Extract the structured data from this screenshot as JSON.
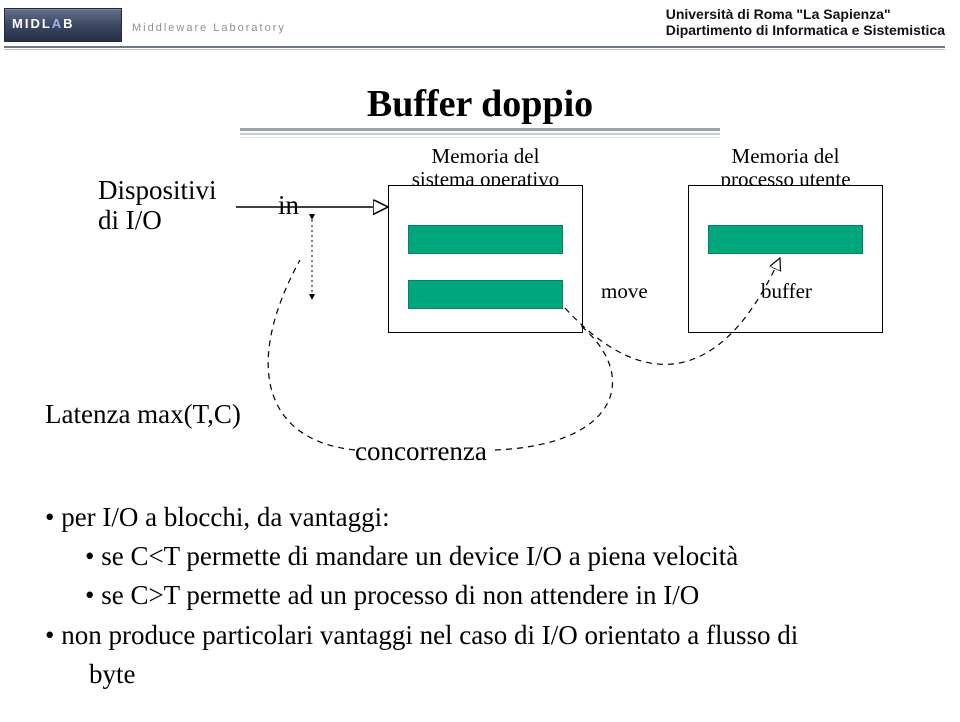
{
  "header": {
    "logo_main": "MIDL",
    "logo_accent": "A",
    "logo_end": "B",
    "logo_subtitle": "Middleware Laboratory",
    "university_line1": "Università di Roma \"La Sapienza\"",
    "university_line2": "Dipartimento di Informatica e Sistemistica"
  },
  "title": "Buffer doppio",
  "diagram": {
    "devices_label": "Dispositivi",
    "devices_label2": "di I/O",
    "in_label": "in",
    "os_memory_caption_l1": "Memoria del",
    "os_memory_caption_l2": "sistema operativo",
    "proc_memory_caption_l1": "Memoria del",
    "proc_memory_caption_l2": "processo utente",
    "move_label": "move",
    "buffer_label": "buffer"
  },
  "body": {
    "latency": "Latenza max(T,C)",
    "concorrenza": "concorrenza",
    "bullet1": "per I/O a blocchi, da vantaggi:",
    "sub1": "se C<T  permette di mandare un device I/O a piena velocità",
    "sub2": "se C>T  permette ad un processo di non attendere in I/O",
    "bullet2": "non produce particolari vantaggi nel caso di I/O orientato a flusso di",
    "bullet2_cont": "byte"
  }
}
